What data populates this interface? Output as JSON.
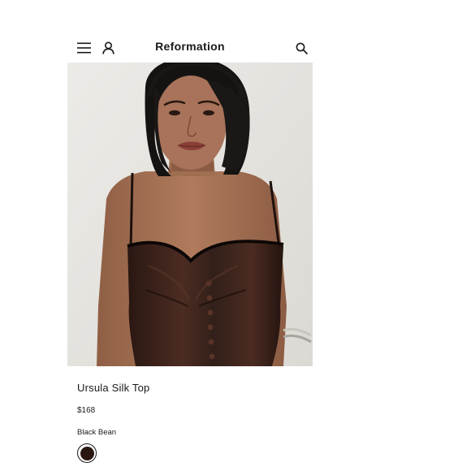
{
  "header": {
    "brand": "Reformation"
  },
  "product": {
    "title": "Ursula Silk Top",
    "price": "$168",
    "color_name": "Black Bean",
    "color_hex": "#2a1712"
  },
  "icons": {
    "menu": "hamburger-menu-icon",
    "account": "account-icon",
    "search": "search-icon"
  },
  "colors": {
    "background": "#ffffff",
    "text": "#1a1a1a",
    "top_fabric": "#3a221b"
  }
}
